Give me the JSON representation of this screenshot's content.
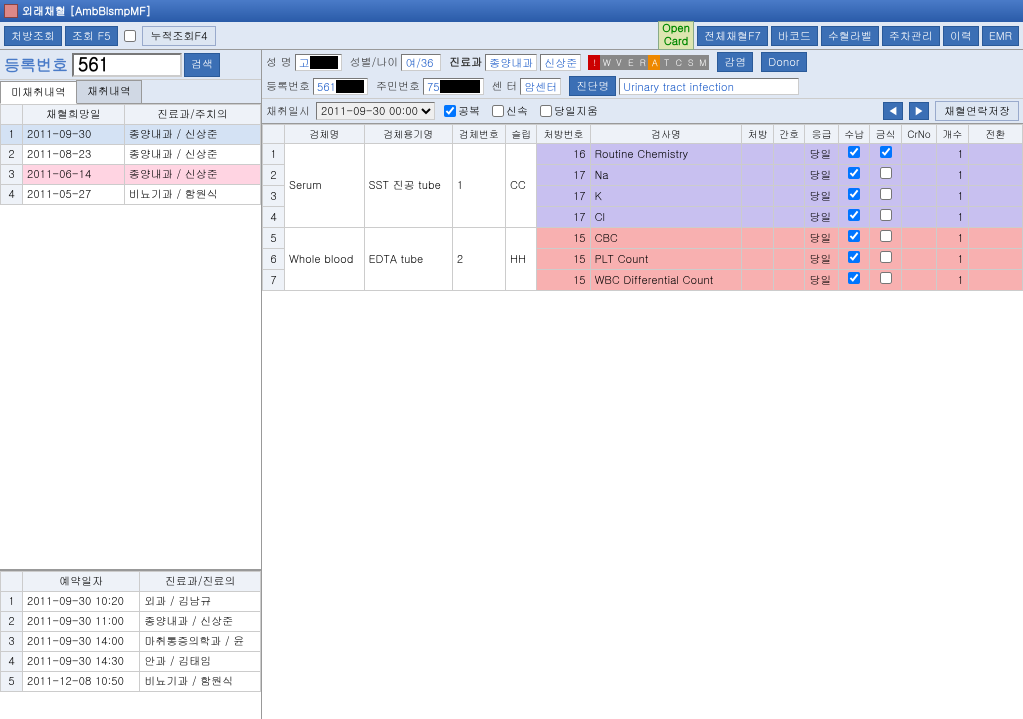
{
  "window": {
    "title": "외래채혈 [AmbBlsmpMF]"
  },
  "toolbar": {
    "prescription_inquiry": "처방조회",
    "inquiry_f5": "조회 F5",
    "track_inquiry_f4": "누적조회F4",
    "total_blood_f7": "전체채혈F7",
    "barcode": "바코드",
    "blood_label": "수혈라벨",
    "parking": "주차관리",
    "history": "이력",
    "emr": "EMR",
    "open_card": "Open\nCard"
  },
  "reg": {
    "label": "등록번호",
    "value": "561",
    "search": "검색"
  },
  "left_tabs": {
    "unpicked": "미채취내역",
    "picked": "채취내역"
  },
  "history_grid": {
    "headers": {
      "date": "채혈희망일",
      "dept": "진료과/주치의"
    },
    "rows": [
      {
        "date": "2011-09-30",
        "dept": "종양내과 / 신상준",
        "sel": true
      },
      {
        "date": "2011-08-23",
        "dept": "종양내과 / 신상준"
      },
      {
        "date": "2011-06-14",
        "dept": "종양내과 / 신상준",
        "pink": true
      },
      {
        "date": "2011-05-27",
        "dept": "비뇨기과 / 함원식"
      }
    ]
  },
  "appt_grid": {
    "headers": {
      "date": "예약일자",
      "dept": "진료과/진료의"
    },
    "rows": [
      {
        "date": "2011-09-30  10:20",
        "dept": "외과 / 김남규"
      },
      {
        "date": "2011-09-30  11:00",
        "dept": "종양내과 / 신상준"
      },
      {
        "date": "2011-09-30  14:00",
        "dept": "마취통증의학과 / 윤"
      },
      {
        "date": "2011-09-30  14:30",
        "dept": "안과 / 김태임"
      },
      {
        "date": "2011-12-08  10:50",
        "dept": "비뇨기과 / 함원식"
      }
    ]
  },
  "patient": {
    "labels": {
      "name": "성    명",
      "sex_age": "성별/나이",
      "dept": "진료과",
      "reg_no": "등록번호",
      "ssn": "주민번호",
      "center": "센    터",
      "diagnosis": "진단명"
    },
    "name_prefix": "고",
    "sex_age": "여/36",
    "dept": "종양내과",
    "doctor": "신상준",
    "reg_no": "561",
    "ssn_prefix": "75",
    "center": "암센터",
    "diagnosis": "Urinary tract infection",
    "flags": [
      "!",
      "W",
      "V",
      "E",
      "R",
      "A",
      "T",
      "C",
      "S",
      "M"
    ],
    "infection": "감염",
    "donor": "Donor"
  },
  "collect": {
    "label": "채취일시",
    "datetime": "2011-09-30 00:00",
    "fasting": "공복",
    "rapid": "신속",
    "same_day_delete": "당일지움",
    "save_contact": "채혈연락저장"
  },
  "main_headers": {
    "specimen": "검체명",
    "container": "검체용기명",
    "specimen_no": "검체번호",
    "slip": "슬립",
    "rx_no": "처방번호",
    "test": "검사명",
    "rx": "처방",
    "nurse": "간호",
    "urgent": "응급",
    "receipt": "수납",
    "diet": "금식",
    "crno": "CrNo",
    "count": "개수",
    "convert": "전환"
  },
  "main_rows": [
    {
      "n": 1,
      "specimen": "Serum",
      "container": "SST 진공 tube",
      "sno": "1",
      "slip": "CC",
      "rxno": "16",
      "test": "Routine Chemistry",
      "urgent": "당일",
      "c1": true,
      "c2": true,
      "cnt": "1",
      "group": "A",
      "gfirst": true,
      "gsize": 4
    },
    {
      "n": 2,
      "rxno": "17",
      "test": "Na",
      "urgent": "당일",
      "c1": true,
      "c2": false,
      "cnt": "1",
      "group": "A"
    },
    {
      "n": 3,
      "rxno": "17",
      "test": "K",
      "urgent": "당일",
      "c1": true,
      "c2": false,
      "cnt": "1",
      "group": "A"
    },
    {
      "n": 4,
      "rxno": "17",
      "test": "Cl",
      "urgent": "당일",
      "c1": true,
      "c2": false,
      "cnt": "1",
      "group": "A"
    },
    {
      "n": 5,
      "specimen": "Whole blood",
      "container": "EDTA tube",
      "sno": "2",
      "slip": "HH",
      "rxno": "15",
      "test": "CBC",
      "urgent": "당일",
      "c1": true,
      "c2": false,
      "cnt": "1",
      "group": "B",
      "gfirst": true,
      "gsize": 3
    },
    {
      "n": 6,
      "rxno": "15",
      "test": "PLT Count",
      "urgent": "당일",
      "c1": true,
      "c2": false,
      "cnt": "1",
      "group": "B"
    },
    {
      "n": 7,
      "rxno": "15",
      "test": "WBC Differential Count",
      "urgent": "당일",
      "c1": true,
      "c2": false,
      "cnt": "1",
      "group": "B"
    }
  ]
}
